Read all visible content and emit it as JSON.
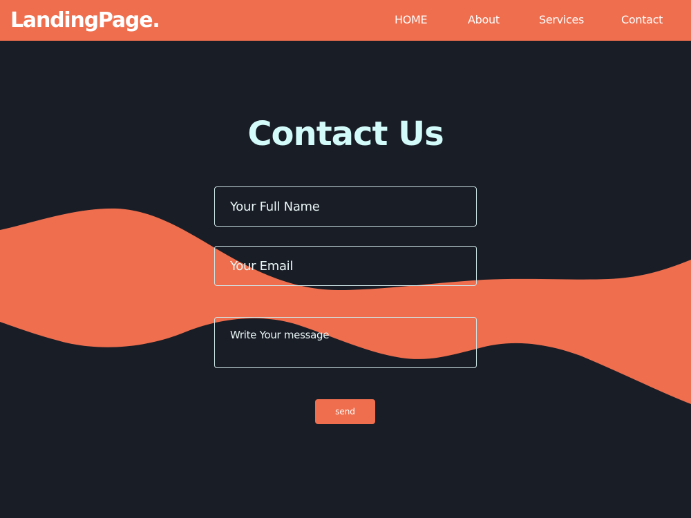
{
  "header": {
    "logo": "LandingPage.",
    "nav": [
      {
        "label": "HOME"
      },
      {
        "label": "About"
      },
      {
        "label": "Services"
      },
      {
        "label": "Contact"
      }
    ]
  },
  "contact": {
    "title": "Contact Us",
    "name_placeholder": "Your Full Name",
    "email_placeholder": "Your Email",
    "message_placeholder": "Write Your message",
    "send_label": "send"
  },
  "colors": {
    "accent": "#ee6e4e",
    "background": "#191d26",
    "title": "#d3fbfa",
    "field_border": "#cfe6e8"
  }
}
